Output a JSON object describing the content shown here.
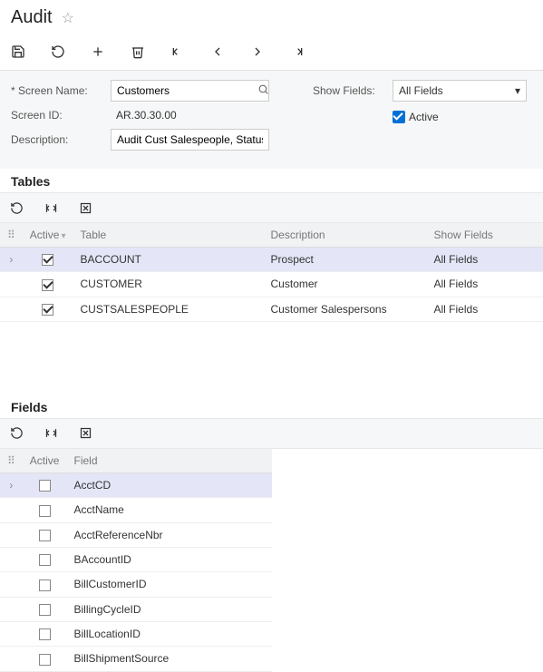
{
  "page": {
    "title": "Audit"
  },
  "form": {
    "screen_name_label": "Screen Name:",
    "screen_name_value": "Customers",
    "screen_id_label": "Screen ID:",
    "screen_id_value": "AR.30.30.00",
    "description_label": "Description:",
    "description_value": "Audit Cust Salespeople, Status",
    "show_fields_label": "Show Fields:",
    "show_fields_value": "All Fields",
    "active_label": "Active",
    "active_checked": true
  },
  "tables_section": {
    "title": "Tables",
    "headers": {
      "active": "Active",
      "table": "Table",
      "description": "Description",
      "show_fields": "Show Fields"
    },
    "rows": [
      {
        "active": true,
        "table": "BACCOUNT",
        "description": "Prospect",
        "show_fields": "All Fields",
        "selected": true
      },
      {
        "active": true,
        "table": "CUSTOMER",
        "description": "Customer",
        "show_fields": "All Fields",
        "selected": false
      },
      {
        "active": true,
        "table": "CUSTSALESPEOPLE",
        "description": "Customer Salespersons",
        "show_fields": "All Fields",
        "selected": false
      }
    ]
  },
  "fields_section": {
    "title": "Fields",
    "headers": {
      "active": "Active",
      "field": "Field"
    },
    "rows": [
      {
        "active": false,
        "field": "AcctCD",
        "selected": true
      },
      {
        "active": false,
        "field": "AcctName",
        "selected": false
      },
      {
        "active": false,
        "field": "AcctReferenceNbr",
        "selected": false
      },
      {
        "active": false,
        "field": "BAccountID",
        "selected": false
      },
      {
        "active": false,
        "field": "BillCustomerID",
        "selected": false
      },
      {
        "active": false,
        "field": "BillingCycleID",
        "selected": false
      },
      {
        "active": false,
        "field": "BillLocationID",
        "selected": false
      },
      {
        "active": false,
        "field": "BillShipmentSource",
        "selected": false
      }
    ]
  }
}
